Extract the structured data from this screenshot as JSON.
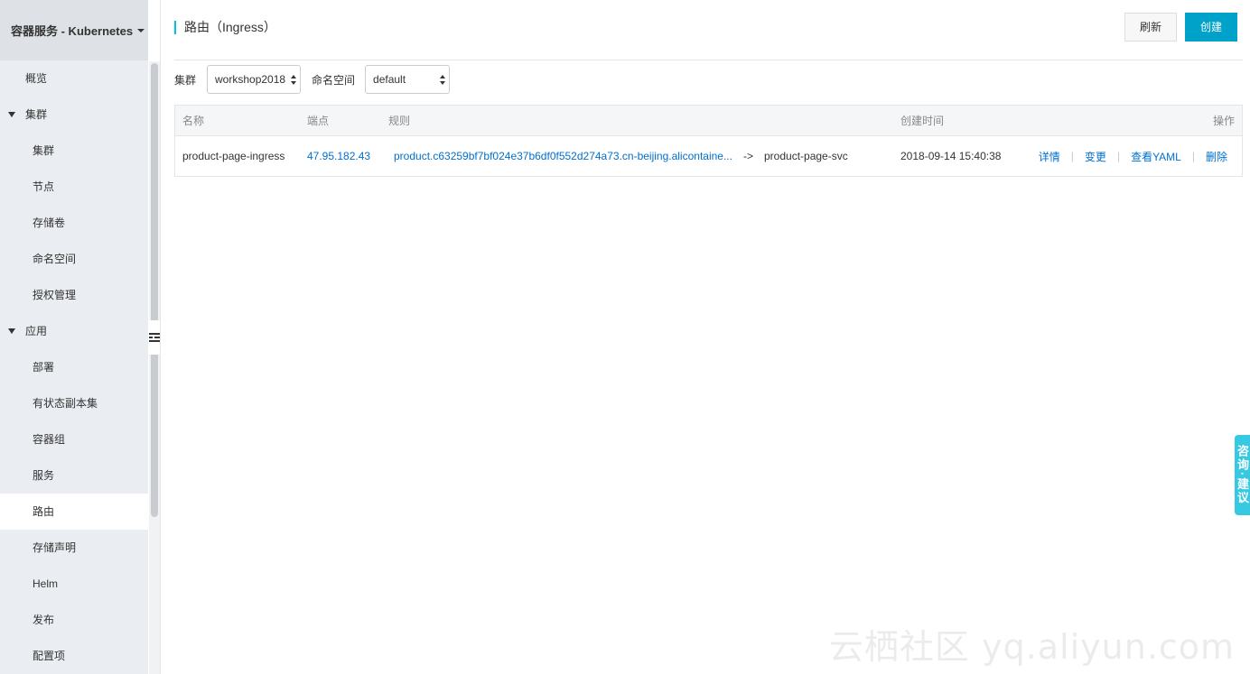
{
  "sidebar": {
    "header": "容器服务 - Kubernetes",
    "items": [
      {
        "label": "概览",
        "type": "level1"
      },
      {
        "label": "集群",
        "type": "group"
      },
      {
        "label": "集群",
        "type": "level2"
      },
      {
        "label": "节点",
        "type": "level2"
      },
      {
        "label": "存储卷",
        "type": "level2"
      },
      {
        "label": "命名空间",
        "type": "level2"
      },
      {
        "label": "授权管理",
        "type": "level2"
      },
      {
        "label": "应用",
        "type": "group"
      },
      {
        "label": "部署",
        "type": "level2"
      },
      {
        "label": "有状态副本集",
        "type": "level2"
      },
      {
        "label": "容器组",
        "type": "level2"
      },
      {
        "label": "服务",
        "type": "level2"
      },
      {
        "label": "路由",
        "type": "level2",
        "active": true
      },
      {
        "label": "存储声明",
        "type": "level2"
      },
      {
        "label": "Helm",
        "type": "level2"
      },
      {
        "label": "发布",
        "type": "level2"
      },
      {
        "label": "配置项",
        "type": "level2"
      }
    ]
  },
  "header": {
    "title": "路由（Ingress）",
    "refresh_label": "刷新",
    "create_label": "创建"
  },
  "filters": {
    "cluster_label": "集群",
    "cluster_value": "workshop2018",
    "namespace_label": "命名空间",
    "namespace_value": "default"
  },
  "table": {
    "columns": {
      "name": "名称",
      "endpoint": "端点",
      "rule": "规则",
      "created": "创建时间",
      "actions": "操作"
    },
    "rows": [
      {
        "name": "product-page-ingress",
        "endpoint": "47.95.182.43",
        "rule_host": "product.c63259bf7bf024e37b6df0f552d274a73.cn-beijing.alicontaine...",
        "rule_arrow": "->",
        "rule_service": "product-page-svc",
        "created": "2018-09-14 15:40:38",
        "actions": {
          "detail": "详情",
          "change": "变更",
          "yaml": "查看YAML",
          "delete": "删除",
          "separator": "|"
        }
      }
    ]
  },
  "feedback": "咨询·建议",
  "watermark": "云栖社区 yq.aliyun.com",
  "colors": {
    "accent": "#00c1de",
    "primary_button": "#00a2ca",
    "link": "#0070cc",
    "sidebar_bg": "#eaedf1"
  },
  "icons": {
    "dropdown": "caret-down-icon",
    "group_expand": "triangle-down-icon",
    "collapse": "collapse-menu-icon"
  }
}
